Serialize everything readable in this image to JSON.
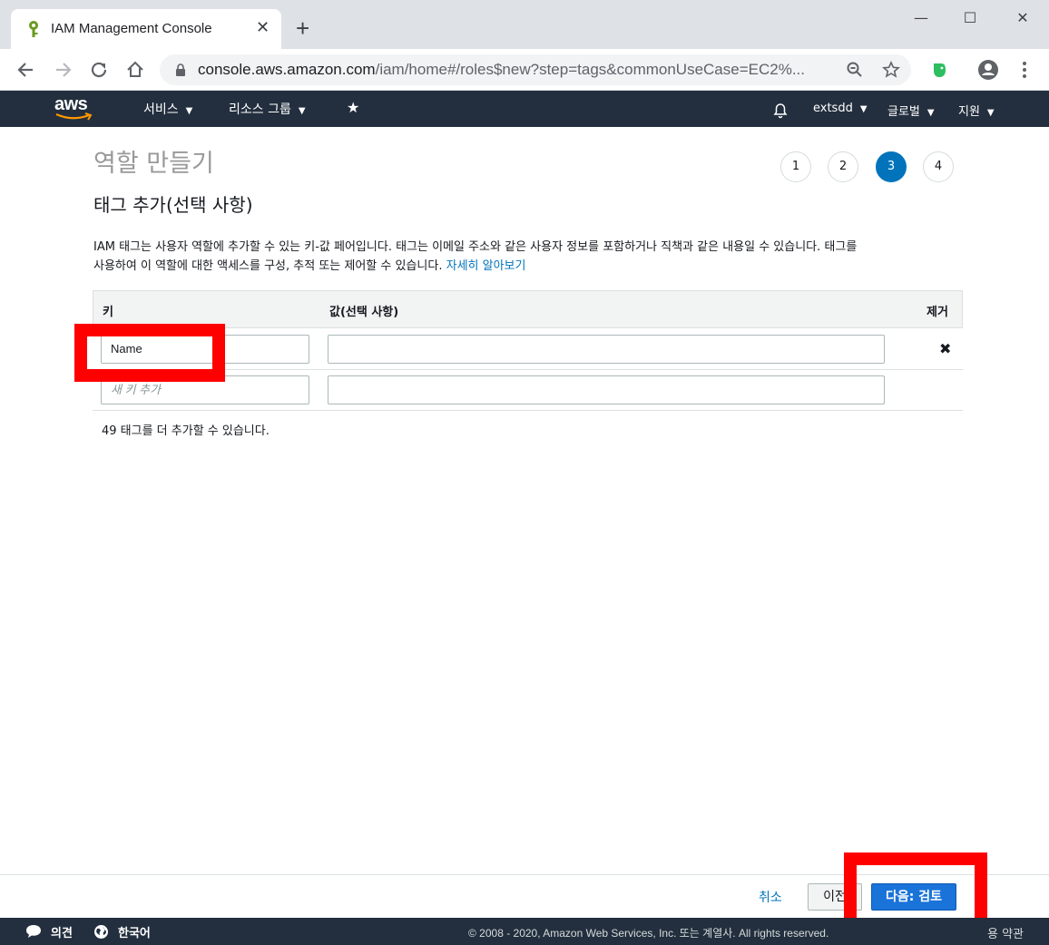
{
  "browser": {
    "tab_title": "IAM Management Console",
    "url_host": "console.aws.amazon.com",
    "url_path": "/iam/home#/roles$new?step=tags&commonUseCase=EC2%..."
  },
  "aws_nav": {
    "services": "서비스",
    "resource_groups": "리소스 그룹",
    "account": "extsdd",
    "region": "글로벌",
    "support": "지원"
  },
  "page": {
    "title": "역할 만들기",
    "steps": [
      "1",
      "2",
      "3",
      "4"
    ],
    "active_step": 3,
    "section_title": "태그 추가(선택 사항)",
    "description_line1": "IAM 태그는 사용자 역할에 추가할 수 있는 키-값 페어입니다. 태그는 이메일 주소와 같은 사용자 정보를 포함하거나 직책과 같은 내용일 수 있습니다. 태그를",
    "description_line2": "사용하여 이 역할에 대한 액세스를 구성, 추적 또는 제어할 수 있습니다.",
    "learn_more": "자세히 알아보기"
  },
  "table": {
    "col_key": "키",
    "col_value": "값(선택 사항)",
    "col_remove": "제거",
    "rows": [
      {
        "key": "Name",
        "value": ""
      }
    ],
    "new_key_placeholder": "새 키 추가",
    "remaining_text": "49 태그를 더 추가할 수 있습니다."
  },
  "actions": {
    "cancel": "취소",
    "previous": "이전",
    "next": "다음: 검토"
  },
  "footer": {
    "feedback": "의견",
    "language": "한국어",
    "copyright": "© 2008 - 2020, Amazon Web Services, Inc. 또는 계열사. All rights reserved.",
    "terms": "용 약관"
  },
  "colors": {
    "aws_nav_bg": "#232f3e",
    "primary_button": "#1a73d9",
    "link": "#0073bb",
    "highlight": "#ff0000"
  }
}
